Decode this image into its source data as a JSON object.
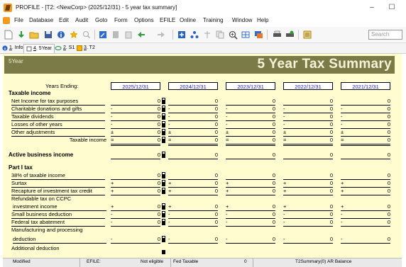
{
  "window": {
    "title": "PROFILE - [T2: <NewCorp> (2025/12/31) - 5 year tax summary]",
    "minimize": "–",
    "maximize": "☐"
  },
  "menu": [
    "File",
    "Database",
    "Edit",
    "Audit",
    "Goto",
    "Form",
    "Options",
    "EFILE",
    "Online",
    "Training",
    "Window",
    "Help"
  ],
  "toolbar": {
    "search_placeholder": "Search"
  },
  "tabs": [
    {
      "num": "1",
      "label": ". Info"
    },
    {
      "num": "4",
      "label": ". 5Year"
    },
    {
      "num": "2",
      "label": ". S1"
    },
    {
      "num": "3",
      "label": ". T2"
    }
  ],
  "form": {
    "header_left": "5Year",
    "title": "5 Year Tax Summary",
    "years_ending_label": "Years Ending:",
    "years": [
      "2025/12/31",
      "2024/12/31",
      "2023/12/31",
      "2022/12/31",
      "2021/12/31"
    ],
    "sections": {
      "taxable_income": "Taxable income",
      "active_business_income": "Active business income",
      "part1_tax": "Part I tax"
    },
    "rows": {
      "net_income": {
        "label": "Net Income for tax purposes",
        "values": [
          "0",
          "0",
          "0",
          "0",
          "0"
        ]
      },
      "charitable": {
        "label": "Charitable donations and gifts",
        "sign": "-",
        "values": [
          "0",
          "0",
          "0",
          "0",
          "0"
        ]
      },
      "taxable_dividends": {
        "label": "Taxable dividends",
        "sign": "-",
        "values": [
          "0",
          "0",
          "0",
          "0",
          "0"
        ]
      },
      "losses": {
        "label": "Losses of other years",
        "sign": "-",
        "values": [
          "0",
          "0",
          "0",
          "0",
          "0"
        ]
      },
      "other_adjustments": {
        "label": "Other adjustments",
        "sign": "±",
        "values": [
          "0",
          "0",
          "0",
          "0",
          "0"
        ]
      },
      "taxable_income_total": {
        "label": "Taxable income",
        "sign": "=",
        "values": [
          "0",
          "0",
          "0",
          "0",
          "0"
        ]
      },
      "active_business_income": {
        "values": [
          "0",
          "0",
          "0",
          "0",
          "0"
        ]
      },
      "rate38": {
        "label": "38% of taxable income",
        "values": [
          "0",
          "0",
          "0",
          "0",
          "0"
        ]
      },
      "surtax": {
        "label": "Surtax",
        "sign": "+",
        "values": [
          "0",
          "0",
          "0",
          "0",
          "0"
        ]
      },
      "recapture": {
        "label": "Recapture of investment tax credit",
        "sign": "+",
        "values": [
          "0",
          "0",
          "0",
          "0",
          "0"
        ]
      },
      "refundable_ccpc_l1": "Refundable tax on CCPC",
      "refundable_ccpc": {
        "label": "investment income",
        "sign": "+",
        "values": [
          "0",
          "0",
          "0",
          "0",
          "0"
        ]
      },
      "small_business": {
        "label": "Small business deduction",
        "sign": "-",
        "values": [
          "0",
          "0",
          "0",
          "0",
          "0"
        ]
      },
      "federal_abatement": {
        "label": "Federal tax abatement",
        "sign": "-",
        "values": [
          "0",
          "0",
          "0",
          "0",
          "0"
        ]
      },
      "manufacturing_l1": "Manufacturing and processing",
      "manufacturing": {
        "label": "deduction",
        "sign": "-",
        "values": [
          "0",
          "0",
          "0",
          "0",
          "0"
        ]
      },
      "additional_deduction": {
        "label": "Additional deduction"
      }
    }
  },
  "statusbar": {
    "modified": "Modified",
    "efile": "EFILE:",
    "efile_status": "Not eligible",
    "fed_taxable": "Fed Taxable",
    "fed_taxable_value": "0",
    "form_ref": "T2Summary(0)",
    "ar_balance": "AR Balance"
  }
}
